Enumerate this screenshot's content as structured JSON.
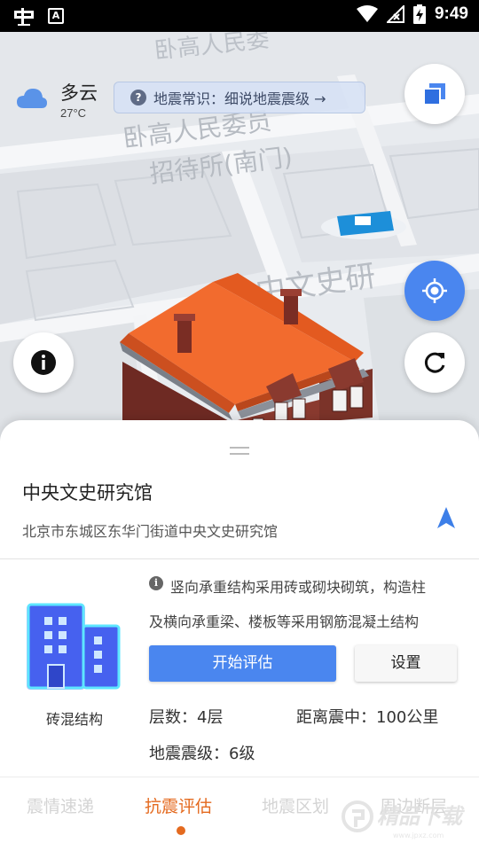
{
  "status_bar": {
    "time": "9:49",
    "badge_letter": "A"
  },
  "weather": {
    "condition": "多云",
    "temperature": "27°C"
  },
  "tip": {
    "icon_text": "?",
    "text": "地震常识：细说地震震级 →"
  },
  "map_labels": {
    "label_1": "卧高人民委员",
    "label_2": "招待所(南门)",
    "label_3": "中文史研",
    "label_4": "卧高人民委"
  },
  "place": {
    "name": "中央文史研究馆",
    "address": "北京市东城区东华门街道中央文史研究馆"
  },
  "building": {
    "type_label": "砖混结构",
    "info_icon_text": "i",
    "description_line1": "竖向承重结构采用砖或砌块砌筑，构造柱",
    "description_line2": "及横向承重梁、楼板等采用钢筋混凝土结构",
    "floors": "层数：4层",
    "distance": "距离震中：100公里",
    "intensity": "地震震级：6级"
  },
  "buttons": {
    "start": "开始评估",
    "settings": "设置"
  },
  "tabs": [
    {
      "label": "震情速递"
    },
    {
      "label": "抗震评估"
    },
    {
      "label": "地震区划"
    },
    {
      "label": "周边断层"
    }
  ],
  "active_tab": "抗震评估",
  "watermark": {
    "text": "精品下载",
    "sub": "www.jpxz.com"
  },
  "colors": {
    "accent_blue": "#4a86ef",
    "active_tab": "#e46a1f",
    "inactive_tab": "#d4d4d4",
    "roof": "#f26b2e",
    "brick": "#7c2f26"
  }
}
